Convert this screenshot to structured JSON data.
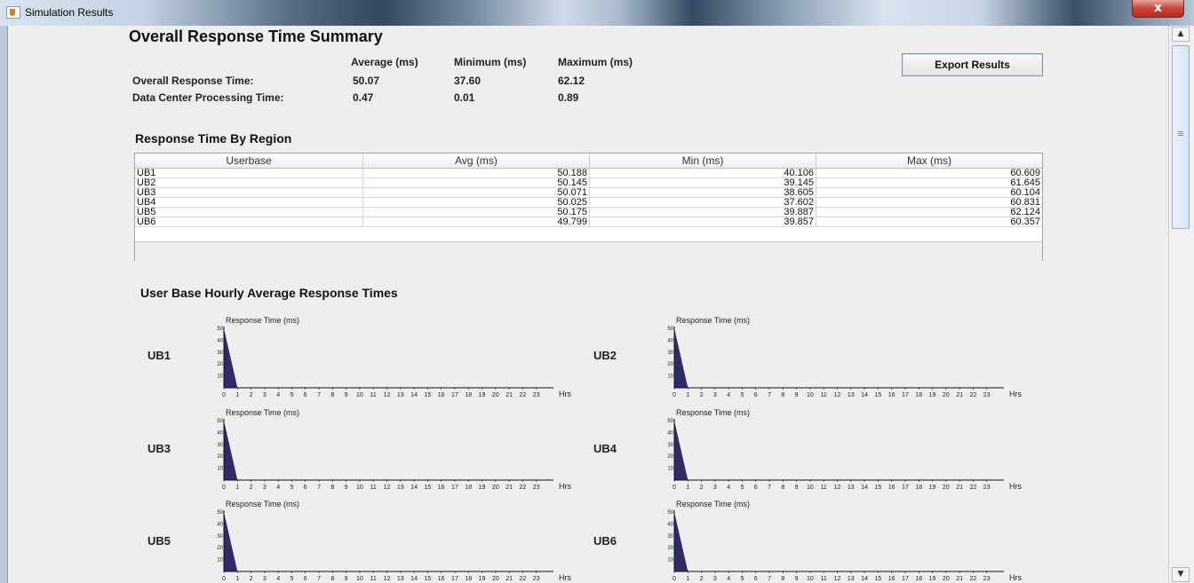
{
  "window": {
    "title": "Simulation Results",
    "close_glyph": "x"
  },
  "summary": {
    "title": "Overall Response Time Summary",
    "columns": [
      "Average (ms)",
      "Minimum (ms)",
      "Maximum (ms)"
    ],
    "rows": [
      {
        "label": "Overall Response Time:",
        "values": [
          "50.07",
          "37.60",
          "62.12"
        ]
      },
      {
        "label": "Data Center Processing Time:",
        "values": [
          "0.47",
          "0.01",
          "0.89"
        ]
      }
    ],
    "export_label": "Export Results"
  },
  "region": {
    "title": "Response Time By Region",
    "headers": [
      "Userbase",
      "Avg (ms)",
      "Min (ms)",
      "Max (ms)"
    ],
    "rows": [
      [
        "UB1",
        "50.188",
        "40.106",
        "60.609"
      ],
      [
        "UB2",
        "50.145",
        "39.145",
        "61.645"
      ],
      [
        "UB3",
        "50.071",
        "38.605",
        "60.104"
      ],
      [
        "UB4",
        "50.025",
        "37.602",
        "60.831"
      ],
      [
        "UB5",
        "50.175",
        "39.887",
        "62.124"
      ],
      [
        "UB6",
        "49.799",
        "39.857",
        "60.357"
      ]
    ]
  },
  "hourly": {
    "title": "User Base Hourly Average Response Times",
    "ub_labels": [
      "UB1",
      "UB2",
      "UB3",
      "UB4",
      "UB5",
      "UB6"
    ]
  },
  "chart_data": [
    {
      "type": "area",
      "xlabel": "Hrs",
      "ylabel": "Response Time (ms)",
      "ylim": [
        0,
        50
      ],
      "y_ticks": [
        "10",
        "20",
        "30",
        "40",
        "50"
      ],
      "x": [
        "0",
        "1",
        "2",
        "3",
        "4",
        "5",
        "6",
        "7",
        "8",
        "9",
        "10",
        "11",
        "12",
        "13",
        "14",
        "15",
        "16",
        "17",
        "18",
        "19",
        "20",
        "21",
        "22",
        "23"
      ],
      "values": [
        50,
        0,
        0,
        0,
        0,
        0,
        0,
        0,
        0,
        0,
        0,
        0,
        0,
        0,
        0,
        0,
        0,
        0,
        0,
        0,
        0,
        0,
        0,
        0
      ]
    },
    {
      "type": "area",
      "xlabel": "Hrs",
      "ylabel": "Response Time (ms)",
      "ylim": [
        0,
        50
      ],
      "y_ticks": [
        "10",
        "20",
        "30",
        "40",
        "50"
      ],
      "x": [
        "0",
        "1",
        "2",
        "3",
        "4",
        "5",
        "6",
        "7",
        "8",
        "9",
        "10",
        "11",
        "12",
        "13",
        "14",
        "15",
        "16",
        "17",
        "18",
        "19",
        "20",
        "21",
        "22",
        "23"
      ],
      "values": [
        50,
        0,
        0,
        0,
        0,
        0,
        0,
        0,
        0,
        0,
        0,
        0,
        0,
        0,
        0,
        0,
        0,
        0,
        0,
        0,
        0,
        0,
        0,
        0
      ]
    },
    {
      "type": "area",
      "xlabel": "Hrs",
      "ylabel": "Response Time (ms)",
      "ylim": [
        0,
        50
      ],
      "y_ticks": [
        "10",
        "20",
        "30",
        "40",
        "50"
      ],
      "x": [
        "0",
        "1",
        "2",
        "3",
        "4",
        "5",
        "6",
        "7",
        "8",
        "9",
        "10",
        "11",
        "12",
        "13",
        "14",
        "15",
        "16",
        "17",
        "18",
        "19",
        "20",
        "21",
        "22",
        "23"
      ],
      "values": [
        50,
        0,
        0,
        0,
        0,
        0,
        0,
        0,
        0,
        0,
        0,
        0,
        0,
        0,
        0,
        0,
        0,
        0,
        0,
        0,
        0,
        0,
        0,
        0
      ]
    },
    {
      "type": "area",
      "xlabel": "Hrs",
      "ylabel": "Response Time (ms)",
      "ylim": [
        0,
        50
      ],
      "y_ticks": [
        "10",
        "20",
        "30",
        "40",
        "50"
      ],
      "x": [
        "0",
        "1",
        "2",
        "3",
        "4",
        "5",
        "6",
        "7",
        "8",
        "9",
        "10",
        "11",
        "12",
        "13",
        "14",
        "15",
        "16",
        "17",
        "18",
        "19",
        "20",
        "21",
        "22",
        "23"
      ],
      "values": [
        50,
        0,
        0,
        0,
        0,
        0,
        0,
        0,
        0,
        0,
        0,
        0,
        0,
        0,
        0,
        0,
        0,
        0,
        0,
        0,
        0,
        0,
        0,
        0
      ]
    },
    {
      "type": "area",
      "xlabel": "Hrs",
      "ylabel": "Response Time (ms)",
      "ylim": [
        0,
        50
      ],
      "y_ticks": [
        "10",
        "20",
        "30",
        "40",
        "50"
      ],
      "x": [
        "0",
        "1",
        "2",
        "3",
        "4",
        "5",
        "6",
        "7",
        "8",
        "9",
        "10",
        "11",
        "12",
        "13",
        "14",
        "15",
        "16",
        "17",
        "18",
        "19",
        "20",
        "21",
        "22",
        "23"
      ],
      "values": [
        50,
        0,
        0,
        0,
        0,
        0,
        0,
        0,
        0,
        0,
        0,
        0,
        0,
        0,
        0,
        0,
        0,
        0,
        0,
        0,
        0,
        0,
        0,
        0
      ]
    },
    {
      "type": "area",
      "xlabel": "Hrs",
      "ylabel": "Response Time (ms)",
      "ylim": [
        0,
        50
      ],
      "y_ticks": [
        "10",
        "20",
        "30",
        "40",
        "50"
      ],
      "x": [
        "0",
        "1",
        "2",
        "3",
        "4",
        "5",
        "6",
        "7",
        "8",
        "9",
        "10",
        "11",
        "12",
        "13",
        "14",
        "15",
        "16",
        "17",
        "18",
        "19",
        "20",
        "21",
        "22",
        "23"
      ],
      "values": [
        50,
        0,
        0,
        0,
        0,
        0,
        0,
        0,
        0,
        0,
        0,
        0,
        0,
        0,
        0,
        0,
        0,
        0,
        0,
        0,
        0,
        0,
        0,
        0
      ]
    }
  ],
  "colors": {
    "area_fill": "#2e2b66",
    "axis": "#111111"
  }
}
